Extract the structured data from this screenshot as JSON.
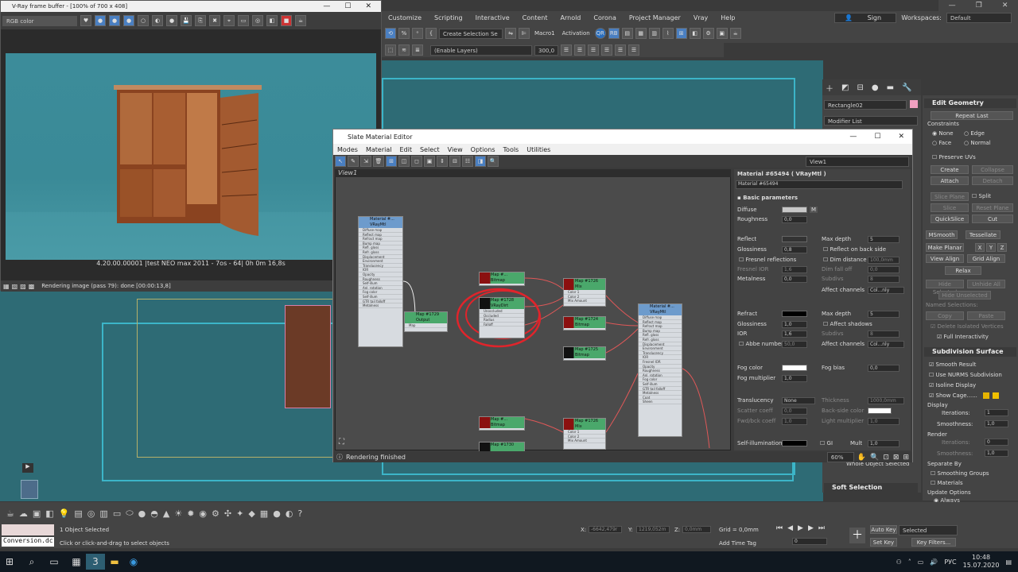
{
  "max_menu": [
    "Customize",
    "Scripting",
    "Interactive",
    "Content",
    "Arnold",
    "Corona",
    "Project Manager",
    "Vray",
    "Help"
  ],
  "max_user": {
    "signin": "Sign In",
    "workspaces_label": "Workspaces:",
    "workspace": "Default"
  },
  "max_toolbar": {
    "selection_set": "Create Selection Se",
    "macro": "Macro1",
    "activation": "Activation",
    "rb": "RB",
    "enable_layers": "(Enable Layers)",
    "value": "300,0"
  },
  "vray_fb": {
    "title": "V-Ray frame buffer - [100% of 700 x 408]",
    "channel": "RGB color",
    "caption": "4.20.00.00001 |test NEO max 2011 - 7os - 64|  0h  0m 16,8s",
    "status": "Rendering image (pass 79): done [00:00:13,8]"
  },
  "slate": {
    "title": "Slate Material Editor",
    "menu": [
      "Modes",
      "Material",
      "Edit",
      "Select",
      "View",
      "Options",
      "Tools",
      "Utilities"
    ],
    "view_combo": "View1",
    "view_tab": "View1",
    "status": "Rendering finished",
    "zoom": "60%"
  },
  "nodes": {
    "mat_main": {
      "title": "Material #...",
      "sub": "VRayMtl",
      "rows": [
        "Diffuse map",
        "Reflect map",
        "Refract map",
        "Bump map",
        "Refl. gloss",
        "Refr. gloss",
        "Displacement",
        "Environment",
        "Translucency",
        "IOR",
        "Opacity",
        "Roughness",
        "Self-illum",
        "Anl. rotation",
        "Fog color",
        "Self-illum",
        "GTR tail falloff",
        "Metalness"
      ]
    },
    "map1729": {
      "title": "Map #1729",
      "sub": "Output",
      "rows": [
        "Map"
      ]
    },
    "map_top": {
      "title": "Map #...",
      "sub": "Bitmap"
    },
    "map1728": {
      "title": "Map #1728",
      "sub": "VRayDirt",
      "rows": [
        "Unoccluded",
        "Occluded",
        "Radius",
        "Falloff"
      ]
    },
    "map1726a": {
      "title": "Map #1726",
      "sub": "Mix",
      "rows": [
        "Color 1",
        "Color 2",
        "Mix Amount"
      ]
    },
    "map1724": {
      "title": "Map #1724",
      "sub": "Bitmap"
    },
    "map1725": {
      "title": "Map #1725",
      "sub": "Bitmap"
    },
    "mat_right": {
      "title": "Material #...",
      "sub": "VRayMtl",
      "rows": [
        "Diffuse map",
        "Reflect map",
        "Refract map",
        "Bump map",
        "Refl. gloss",
        "Refr. gloss",
        "Displacement",
        "Environment",
        "Translucency",
        "IOR",
        "Fresnel IOR",
        "Opacity",
        "Roughness",
        "Anl. rotation",
        "Fog color",
        "Self-illum",
        "GTR tail falloff",
        "Metalness",
        "Coat",
        "Sheen"
      ]
    },
    "map1726b": {
      "title": "Map #1726",
      "sub": "Mix",
      "rows": [
        "Color 1",
        "Color 2",
        "Mix Amount"
      ]
    },
    "map_low1": {
      "title": "Map #...",
      "sub": "Bitmap"
    },
    "map1730": {
      "title": "Map #1730",
      "sub": "Bitmap"
    }
  },
  "params": {
    "header": "Material #65494  ( VRayMtl )",
    "name": "Material #65494",
    "basic": "Basic parameters",
    "diffuse": "Diffuse",
    "m": "M",
    "roughness": "Roughness",
    "roughness_val": "0,0",
    "reflect": "Reflect",
    "max_depth": "Max depth",
    "max_depth_val": "5",
    "glossiness": "Glossiness",
    "gloss_val": "0,8",
    "reflect_back": "Reflect on back side",
    "fresnel": "Fresnel reflections",
    "dim_distance": "Dim distance",
    "dim_distance_val": "100,0mm",
    "fresnel_ior": "Fresnel IOR",
    "fresnel_ior_val": "1,6",
    "dim_falloff": "Dim fall off",
    "dim_falloff_val": "0,0",
    "metalness": "Metalness",
    "metalness_val": "0,0",
    "subdivs": "Subdivs",
    "subdivs_val": "8",
    "affect_channels": "Affect channels",
    "affect_val": "Col...nly",
    "refract": "Refract",
    "refr_max_depth_val": "5",
    "refr_gloss_val": "1,0",
    "affect_shadows": "Affect shadows",
    "ior": "IOR",
    "ior_val": "1,6",
    "refr_subdivs_val": "8",
    "abbe": "Abbe number",
    "abbe_val": "50,0",
    "refr_affect_val": "Col...nly",
    "fog_color": "Fog color",
    "fog_bias": "Fog bias",
    "fog_bias_val": "0,0",
    "fog_mult": "Fog multiplier",
    "fog_mult_val": "1,0",
    "translucency": "Translucency",
    "transl_val": "None",
    "thickness": "Thickness",
    "thickness_val": "1000,0mm",
    "scatter": "Scatter coeff",
    "scatter_val": "0,0",
    "backside": "Back-side color",
    "fwd_bck": "Fwd/bck coeff",
    "fwd_bck_val": "1,0",
    "light_mult": "Light multiplier",
    "light_mult_val": "1,0",
    "self_illum": "Self-illumination",
    "gi": "GI",
    "mult": "Mult",
    "mult_val": "1,0"
  },
  "cmd": {
    "object_name": "Rectangle02",
    "modifier_list": "Modifier List",
    "whole_object": "Whole Object Selected",
    "soft_selection": "Soft Selection"
  },
  "edit_geom": {
    "title": "Edit Geometry",
    "repeat_last": "Repeat Last",
    "constraints": "Constraints",
    "none": "None",
    "edge": "Edge",
    "face": "Face",
    "normal": "Normal",
    "preserve_uvs": "Preserve UVs",
    "create": "Create",
    "collapse": "Collapse",
    "attach": "Attach",
    "detach": "Detach",
    "slice_plane": "Slice Plane",
    "split": "Split",
    "slice": "Slice",
    "reset_plane": "Reset Plane",
    "quickslice": "QuickSlice",
    "cut": "Cut",
    "msmooth": "MSmooth",
    "tessellate": "Tessellate",
    "make_planar": "Make Planar",
    "x": "X",
    "y": "Y",
    "z": "Z",
    "view_align": "View Align",
    "grid_align": "Grid Align",
    "relax": "Relax",
    "hide_selected": "Hide Selected",
    "unhide_all": "Unhide All",
    "hide_unselected": "Hide Unselected",
    "named_sel": "Named Selections:",
    "copy": "Copy",
    "paste": "Paste",
    "delete_isolated": "Delete Isolated Vertices",
    "full_interactivity": "Full Interactivity"
  },
  "subdiv": {
    "title": "Subdivision Surface",
    "smooth_result": "Smooth Result",
    "use_nurms": "Use NURMS Subdivision",
    "isoline": "Isoline Display",
    "show_cage": "Show Cage......",
    "display": "Display",
    "iterations": "Iterations:",
    "iter_val": "1",
    "smoothness": "Smoothness:",
    "smooth_val": "1,0",
    "render": "Render",
    "render_iter_val": "0",
    "render_smooth_val": "1,0",
    "separate_by": "Separate By",
    "smoothing_groups": "Smoothing Groups",
    "materials": "Materials",
    "update_options": "Update Options",
    "always": "Always"
  },
  "status": {
    "conversion": "Conversion.dc",
    "objects": "1 Object Selected",
    "hint": "Click or click-and-drag to select objects",
    "x_label": "X:",
    "x_val": "-6642,479r",
    "y_label": "Y:",
    "y_val": "1219,052m",
    "z_label": "Z:",
    "z_val": "0,0mm",
    "grid": "Grid = 0,0mm",
    "add_time_tag": "Add Time Tag",
    "auto_key": "Auto Key",
    "selected": "Selected",
    "set_key": "Set Key",
    "key_filters": "Key Filters...",
    "frame": "0"
  },
  "taskbar": {
    "lang": "РУС",
    "time": "10:48",
    "date": "15.07.2020"
  },
  "colors": {
    "annotation": "#e0242b",
    "node_green": "#4aa86b",
    "viewport": "#2e6b75"
  }
}
